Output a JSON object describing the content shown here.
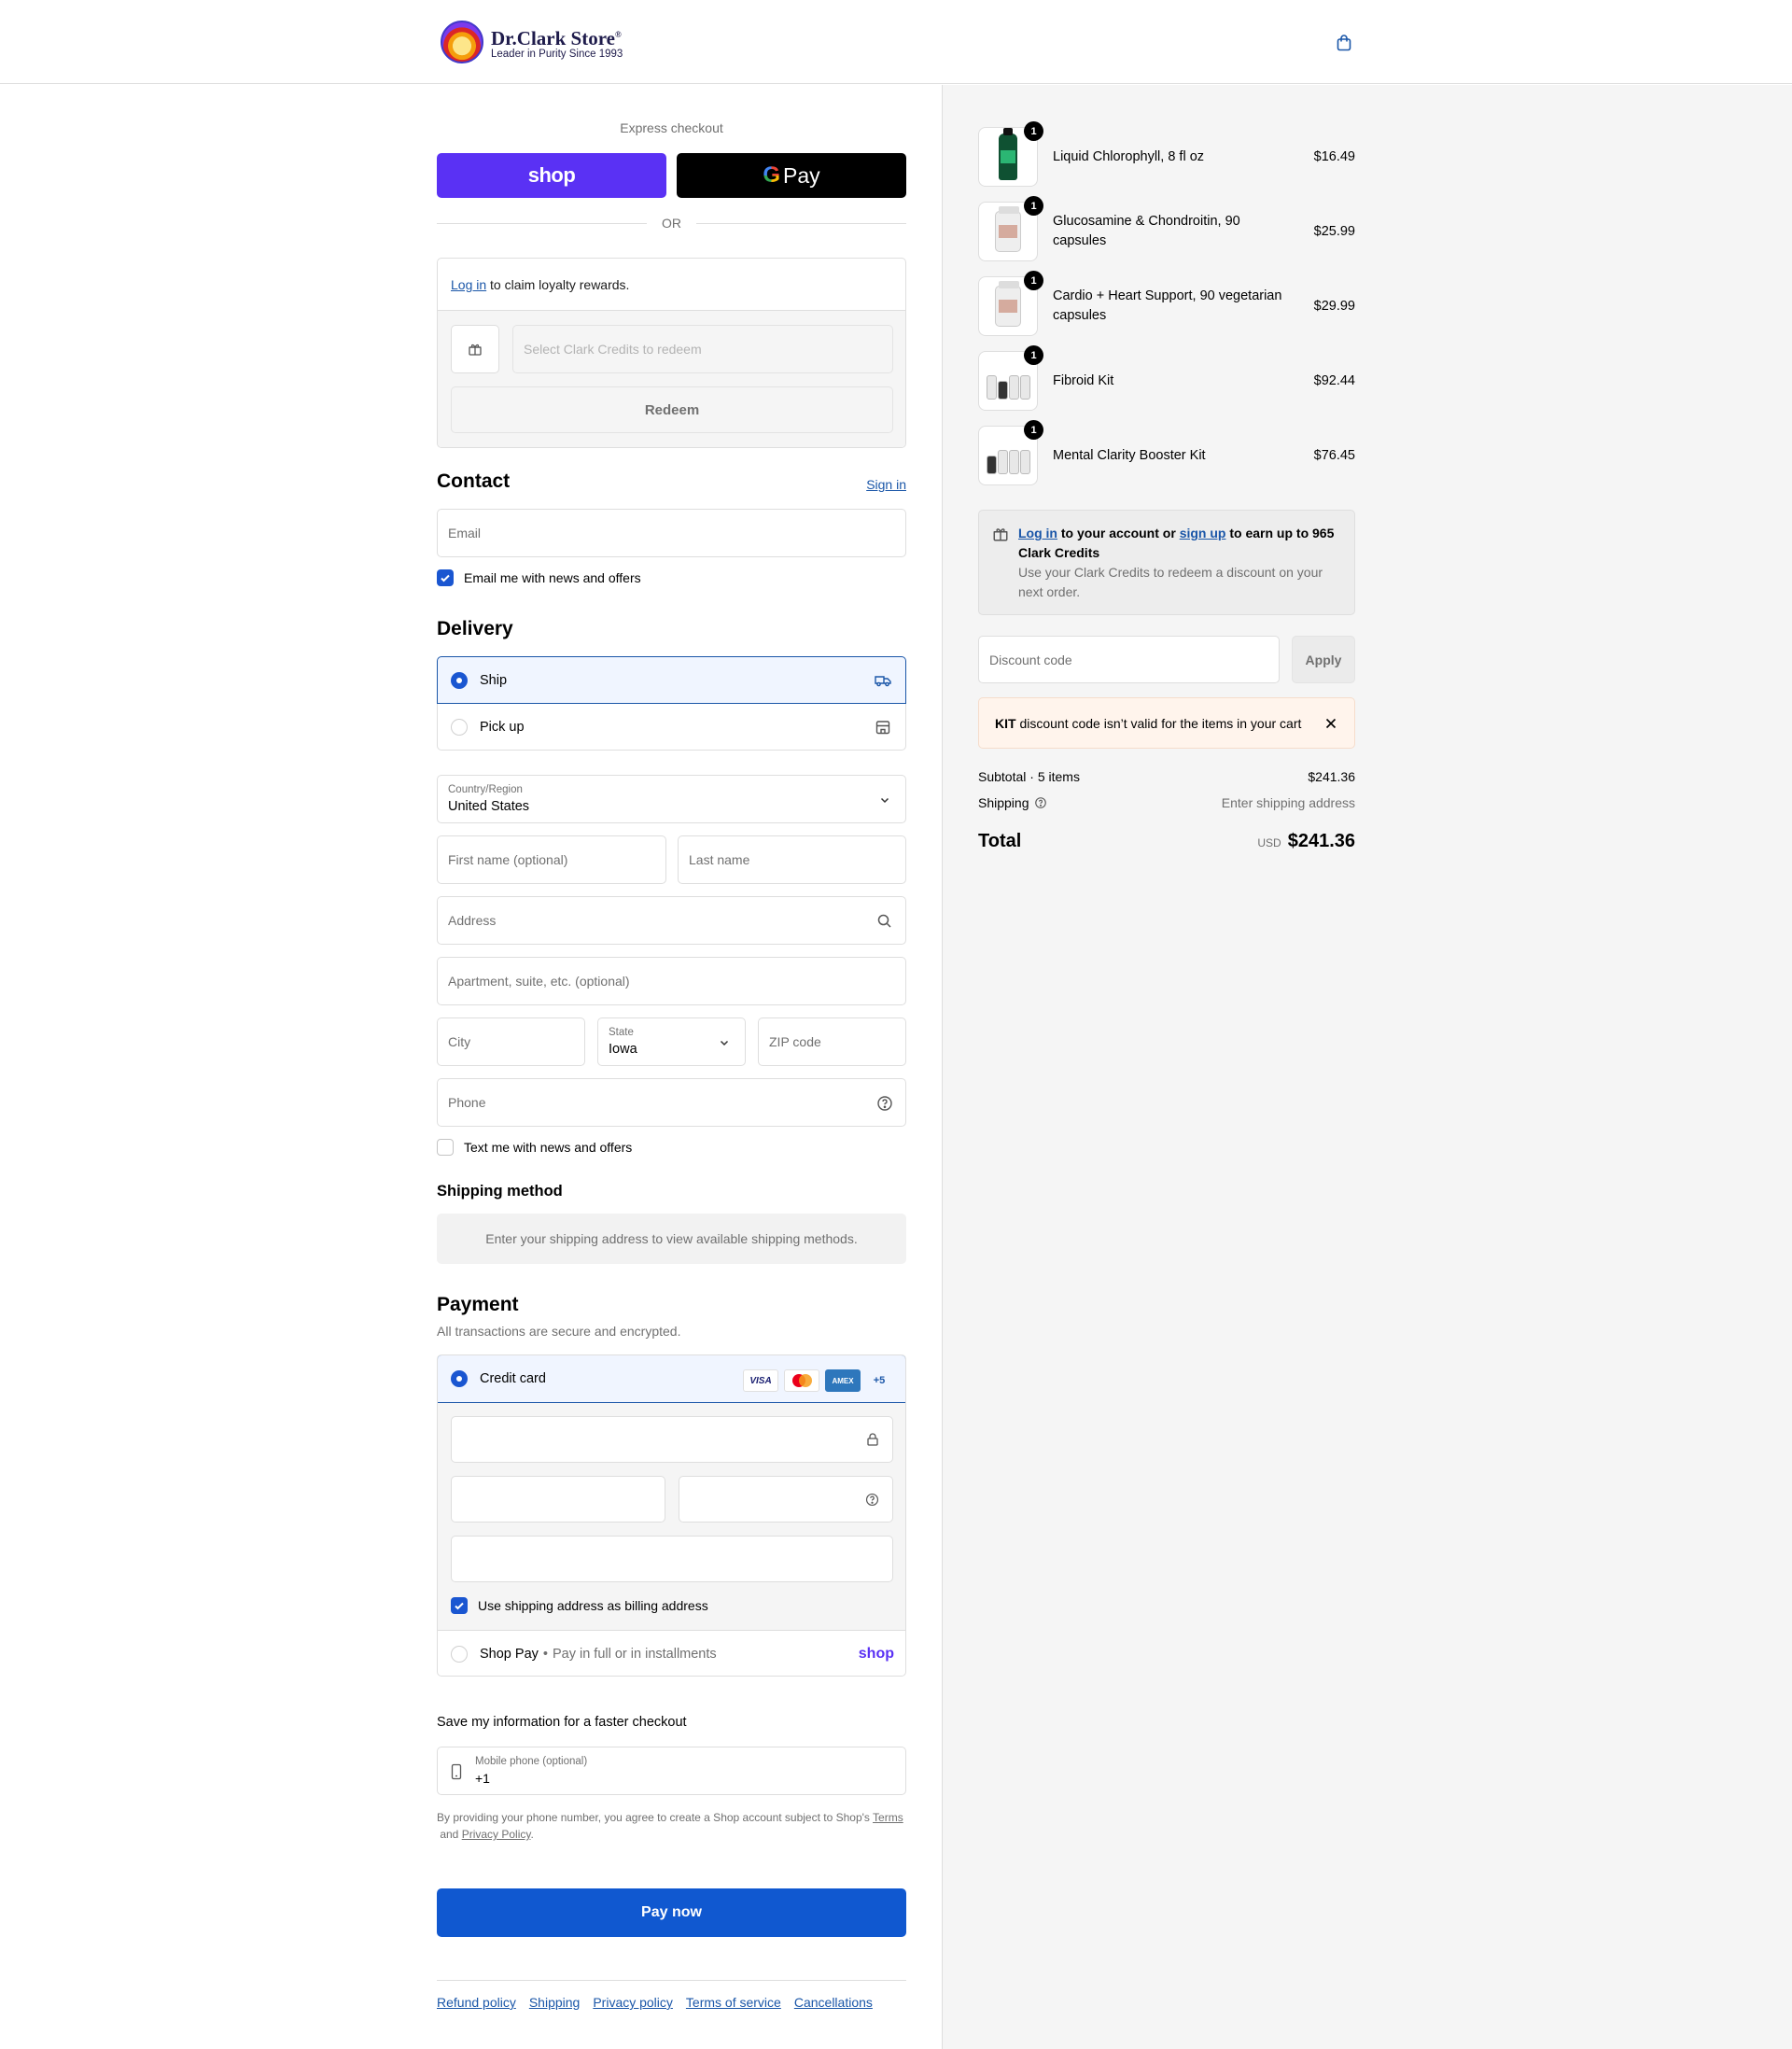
{
  "header": {
    "logo_title": "Dr.Clark Store",
    "logo_reg": "®",
    "logo_tagline": "Leader in Purity Since 1993",
    "cart_icon": "shopping-bag-icon"
  },
  "express": {
    "label": "Express checkout",
    "shop_pay_label": "shop",
    "gpay_g": "G",
    "gpay_label": "Pay",
    "or_label": "OR"
  },
  "loyalty": {
    "login_link": "Log in",
    "login_text": " to claim loyalty rewards.",
    "credits_placeholder": "Select Clark Credits to redeem",
    "redeem_label": "Redeem"
  },
  "contact": {
    "title": "Contact",
    "sign_in": "Sign in",
    "email_placeholder": "Email",
    "news_label": "Email me with news and offers",
    "news_checked": true
  },
  "delivery": {
    "title": "Delivery",
    "options": [
      {
        "label": "Ship",
        "selected": true,
        "icon": "truck-icon"
      },
      {
        "label": "Pick up",
        "selected": false,
        "icon": "store-icon"
      }
    ],
    "country_label": "Country/Region",
    "country_value": "United States",
    "first_name_placeholder": "First name (optional)",
    "last_name_placeholder": "Last name",
    "address_placeholder": "Address",
    "apartment_placeholder": "Apartment, suite, etc. (optional)",
    "city_placeholder": "City",
    "state_label": "State",
    "state_value": "Iowa",
    "zip_placeholder": "ZIP code",
    "phone_placeholder": "Phone",
    "text_label": "Text me with news and offers",
    "text_checked": false
  },
  "shipping_method": {
    "title": "Shipping method",
    "message": "Enter your shipping address to view available shipping methods."
  },
  "payment": {
    "title": "Payment",
    "subtitle": "All transactions are secure and encrypted.",
    "credit_card_label": "Credit card",
    "cards": [
      "VISA",
      "Mastercard",
      "AMEX"
    ],
    "more_cards": "+5",
    "billing_label": "Use shipping address as billing address",
    "billing_checked": true,
    "shop_pay_label": "Shop Pay",
    "shop_pay_desc": "Pay in full or in installments",
    "shop_pay_logo": "shop"
  },
  "save_info": {
    "label": "Save my information for a faster checkout",
    "mobile_label": "Mobile phone (optional)",
    "mobile_value": "+1",
    "legal_prefix": "By providing your phone number, you agree to create a Shop account subject to Shop's ",
    "terms_link": "Terms",
    "legal_and": " and ",
    "privacy_link": "Privacy Policy",
    "legal_suffix": "."
  },
  "pay_now_label": "Pay now",
  "footer_links": [
    "Refund policy",
    "Shipping",
    "Privacy policy",
    "Terms of service",
    "Cancellations"
  ],
  "cart": {
    "items": [
      {
        "name": "Liquid Chlorophyll, 8 fl oz",
        "price": "$16.49",
        "qty": "1"
      },
      {
        "name": "Glucosamine & Chondroitin, 90 capsules",
        "price": "$25.99",
        "qty": "1"
      },
      {
        "name": "Cardio + Heart Support, 90 vegetarian capsules",
        "price": "$29.99",
        "qty": "1"
      },
      {
        "name": "Fibroid Kit",
        "price": "$92.44",
        "qty": "1"
      },
      {
        "name": "Mental Clarity Booster Kit",
        "price": "$76.45",
        "qty": "1"
      }
    ],
    "credits": {
      "login_link": "Log in",
      "mid_text": " to your account or ",
      "signup_link": "sign up",
      "end_text": " to earn up to 965 Clark Credits",
      "sub_text": "Use your Clark Credits to redeem a discount on your next order."
    },
    "discount_placeholder": "Discount code",
    "apply_label": "Apply",
    "error": {
      "code": "KIT",
      "message": " discount code isn’t valid for the items in your cart"
    },
    "subtotal_label": "Subtotal · 5 items",
    "subtotal_value": "$241.36",
    "shipping_label": "Shipping",
    "shipping_value": "Enter shipping address",
    "total_label": "Total",
    "total_currency": "USD",
    "total_value": "$241.36"
  },
  "colors": {
    "accent": "#1058d0",
    "shop_pay": "#5a31f4",
    "link": "#1a56a8",
    "error_bg": "#fff4ec"
  }
}
